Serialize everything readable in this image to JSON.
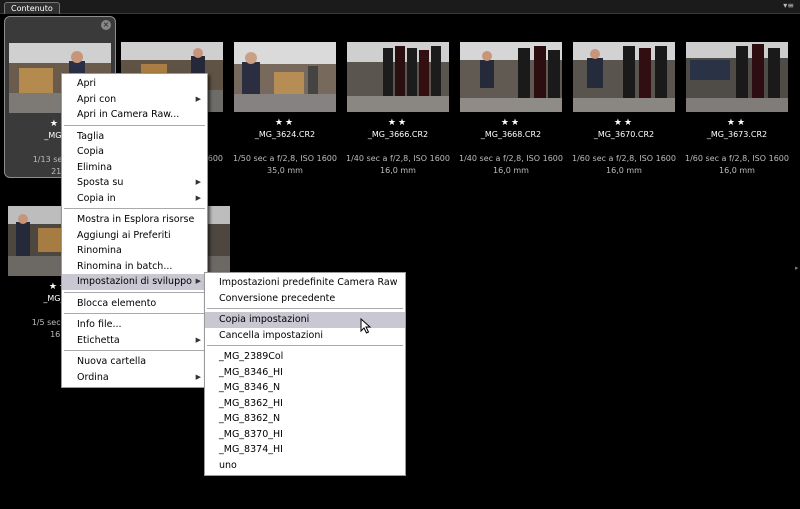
{
  "panel": {
    "tab_label": "Contenuto",
    "menu_icon_glyph": "▾≡"
  },
  "thumbnails": [
    {
      "name": "_MG_35",
      "stars": "★★",
      "meta1": "1/13 sec a f/6",
      "meta2": "21,0"
    },
    {
      "name": "",
      "stars": "",
      "meta1": "1600",
      "meta2": ""
    },
    {
      "name": "_MG_3624.CR2",
      "stars": "★★",
      "meta1": "1/50 sec a f/2,8, ISO 1600",
      "meta2": "35,0 mm"
    },
    {
      "name": "_MG_3666.CR2",
      "stars": "★★",
      "meta1": "1/40 sec a f/2,8, ISO 1600",
      "meta2": "16,0 mm"
    },
    {
      "name": "_MG_3668.CR2",
      "stars": "★★",
      "meta1": "1/40 sec a f/2,8, ISO 1600",
      "meta2": "16,0 mm"
    },
    {
      "name": "_MG_3670.CR2",
      "stars": "★★",
      "meta1": "1/60 sec a f/2,8, ISO 1600",
      "meta2": "16,0 mm"
    },
    {
      "name": "_MG_3673.CR2",
      "stars": "★★",
      "meta1": "1/60 sec a f/2,8, ISO 1600",
      "meta2": "16,0 mm"
    },
    {
      "name": "_MG_36",
      "stars": "★★",
      "meta1": "1/5 sec a f/14",
      "meta2": "16,0"
    }
  ],
  "context_menu": {
    "items": [
      "Apri",
      "Apri con",
      "Apri in Camera Raw...",
      "Taglia",
      "Copia",
      "Elimina",
      "Sposta su",
      "Copia in",
      "Mostra in Esplora risorse",
      "Aggiungi ai Preferiti",
      "Rinomina",
      "Rinomina in batch...",
      "Impostazioni di sviluppo",
      "Blocca elemento",
      "Info file...",
      "Etichetta",
      "Nuova cartella",
      "Ordina"
    ]
  },
  "submenu": {
    "items": [
      "Impostazioni predefinite Camera Raw",
      "Conversione precedente",
      "Copia impostazioni",
      "Cancella impostazioni",
      "_MG_2389Col",
      "_MG_8346_HI",
      "_MG_8346_N",
      "_MG_8362_HI",
      "_MG_8362_N",
      "_MG_8370_HI",
      "_MG_8374_HI",
      "uno"
    ]
  },
  "colors": {
    "menu_highlight": "#c8c7d2",
    "selected_cell": "#3a3a3a"
  }
}
